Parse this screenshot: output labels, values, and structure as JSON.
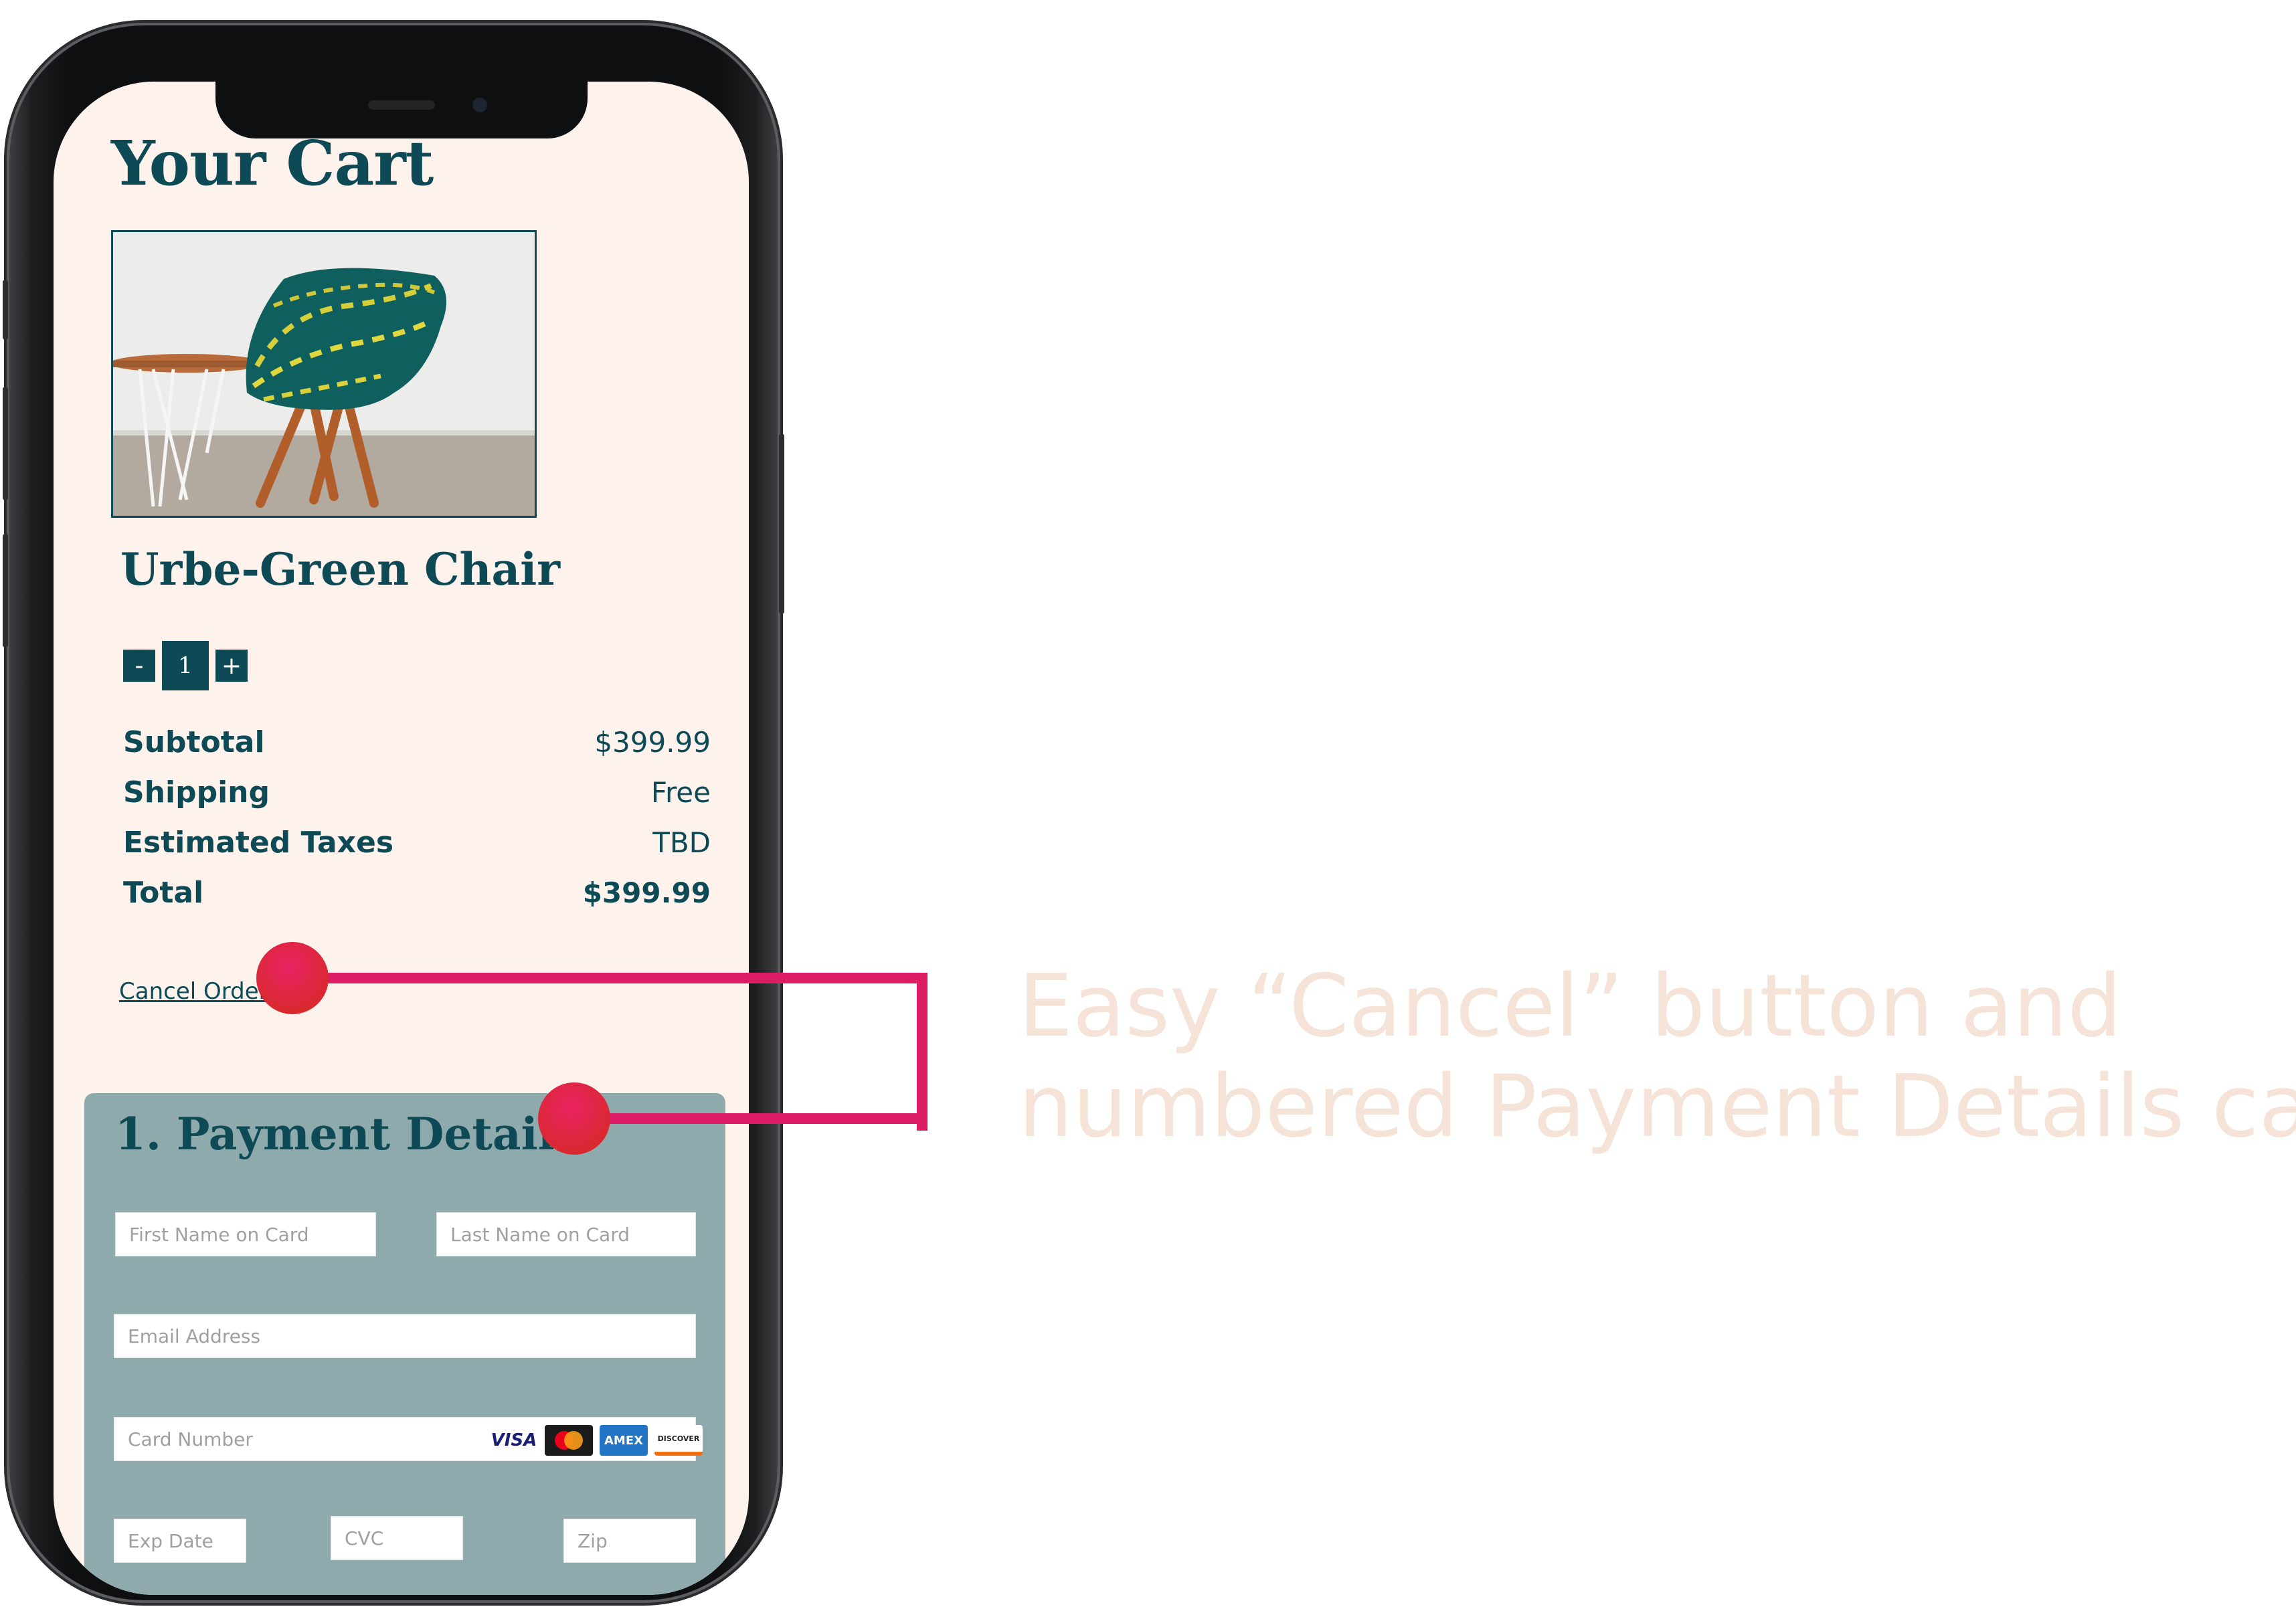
{
  "cart": {
    "title": "Your Cart",
    "product_name": "Urbe-Green Chair",
    "quantity": {
      "decrement_label": "-",
      "value": "1",
      "increment_label": "+"
    },
    "totals": [
      {
        "label": "Subtotal",
        "value": "$399.99"
      },
      {
        "label": "Shipping",
        "value": "Free"
      },
      {
        "label": "Estimated Taxes",
        "value": "TBD"
      },
      {
        "label": "Total",
        "value": "$399.99"
      }
    ],
    "cancel_label": "Cancel Order"
  },
  "payment": {
    "title": "1.  Payment Details",
    "fields": {
      "first_name": "First Name on Card",
      "last_name": "Last Name on Card",
      "email": "Email Address",
      "card_number": "Card Number",
      "exp_date": "Exp Date",
      "cvc": "CVC",
      "zip": "Zip"
    },
    "card_logos": [
      "VISA",
      "Mastercard",
      "AMEX",
      "DISCOVER"
    ]
  },
  "annotation": {
    "line1": "Easy “Cancel” button and",
    "line2": "numbered Payment Details card",
    "accent_color": "#de1d67"
  },
  "colors": {
    "brand": "#0d4a55",
    "screen_bg": "#fdf2ec",
    "card_bg": "#8faaad"
  }
}
